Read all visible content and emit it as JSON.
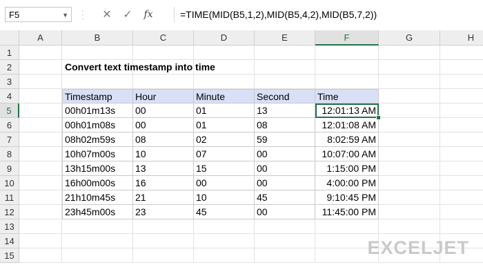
{
  "formula_bar": {
    "name_box": "F5",
    "cancel_icon": "✕",
    "enter_icon": "✓",
    "fx_label": "fx",
    "formula": "=TIME(MID(B5,1,2),MID(B5,4,2),MID(B5,7,2))"
  },
  "columns": [
    "A",
    "B",
    "C",
    "D",
    "E",
    "F",
    "G",
    "H"
  ],
  "rows": [
    "1",
    "2",
    "3",
    "4",
    "5",
    "6",
    "7",
    "8",
    "9",
    "10",
    "11",
    "12",
    "13",
    "14",
    "15"
  ],
  "active_cell": {
    "column": "F",
    "row": "5"
  },
  "sheet": {
    "title": "Convert text timestamp into time",
    "table": {
      "headers": [
        "Timestamp",
        "Hour",
        "Minute",
        "Second",
        "Time"
      ],
      "rows": [
        [
          "00h01m13s",
          "00",
          "01",
          "13",
          "12:01:13 AM"
        ],
        [
          "00h01m08s",
          "00",
          "01",
          "08",
          "12:01:08 AM"
        ],
        [
          "08h02m59s",
          "08",
          "02",
          "59",
          "8:02:59 AM"
        ],
        [
          "10h07m00s",
          "10",
          "07",
          "00",
          "10:07:00 AM"
        ],
        [
          "13h15m00s",
          "13",
          "15",
          "00",
          "1:15:00 PM"
        ],
        [
          "16h00m00s",
          "16",
          "00",
          "00",
          "4:00:00 PM"
        ],
        [
          "21h10m45s",
          "21",
          "10",
          "45",
          "9:10:45 PM"
        ],
        [
          "23h45m00s",
          "23",
          "45",
          "00",
          "11:45:00 PM"
        ]
      ]
    }
  },
  "brand": "EXCELJET",
  "colors": {
    "accent": "#217346",
    "header_fill": "#d9dff6"
  }
}
